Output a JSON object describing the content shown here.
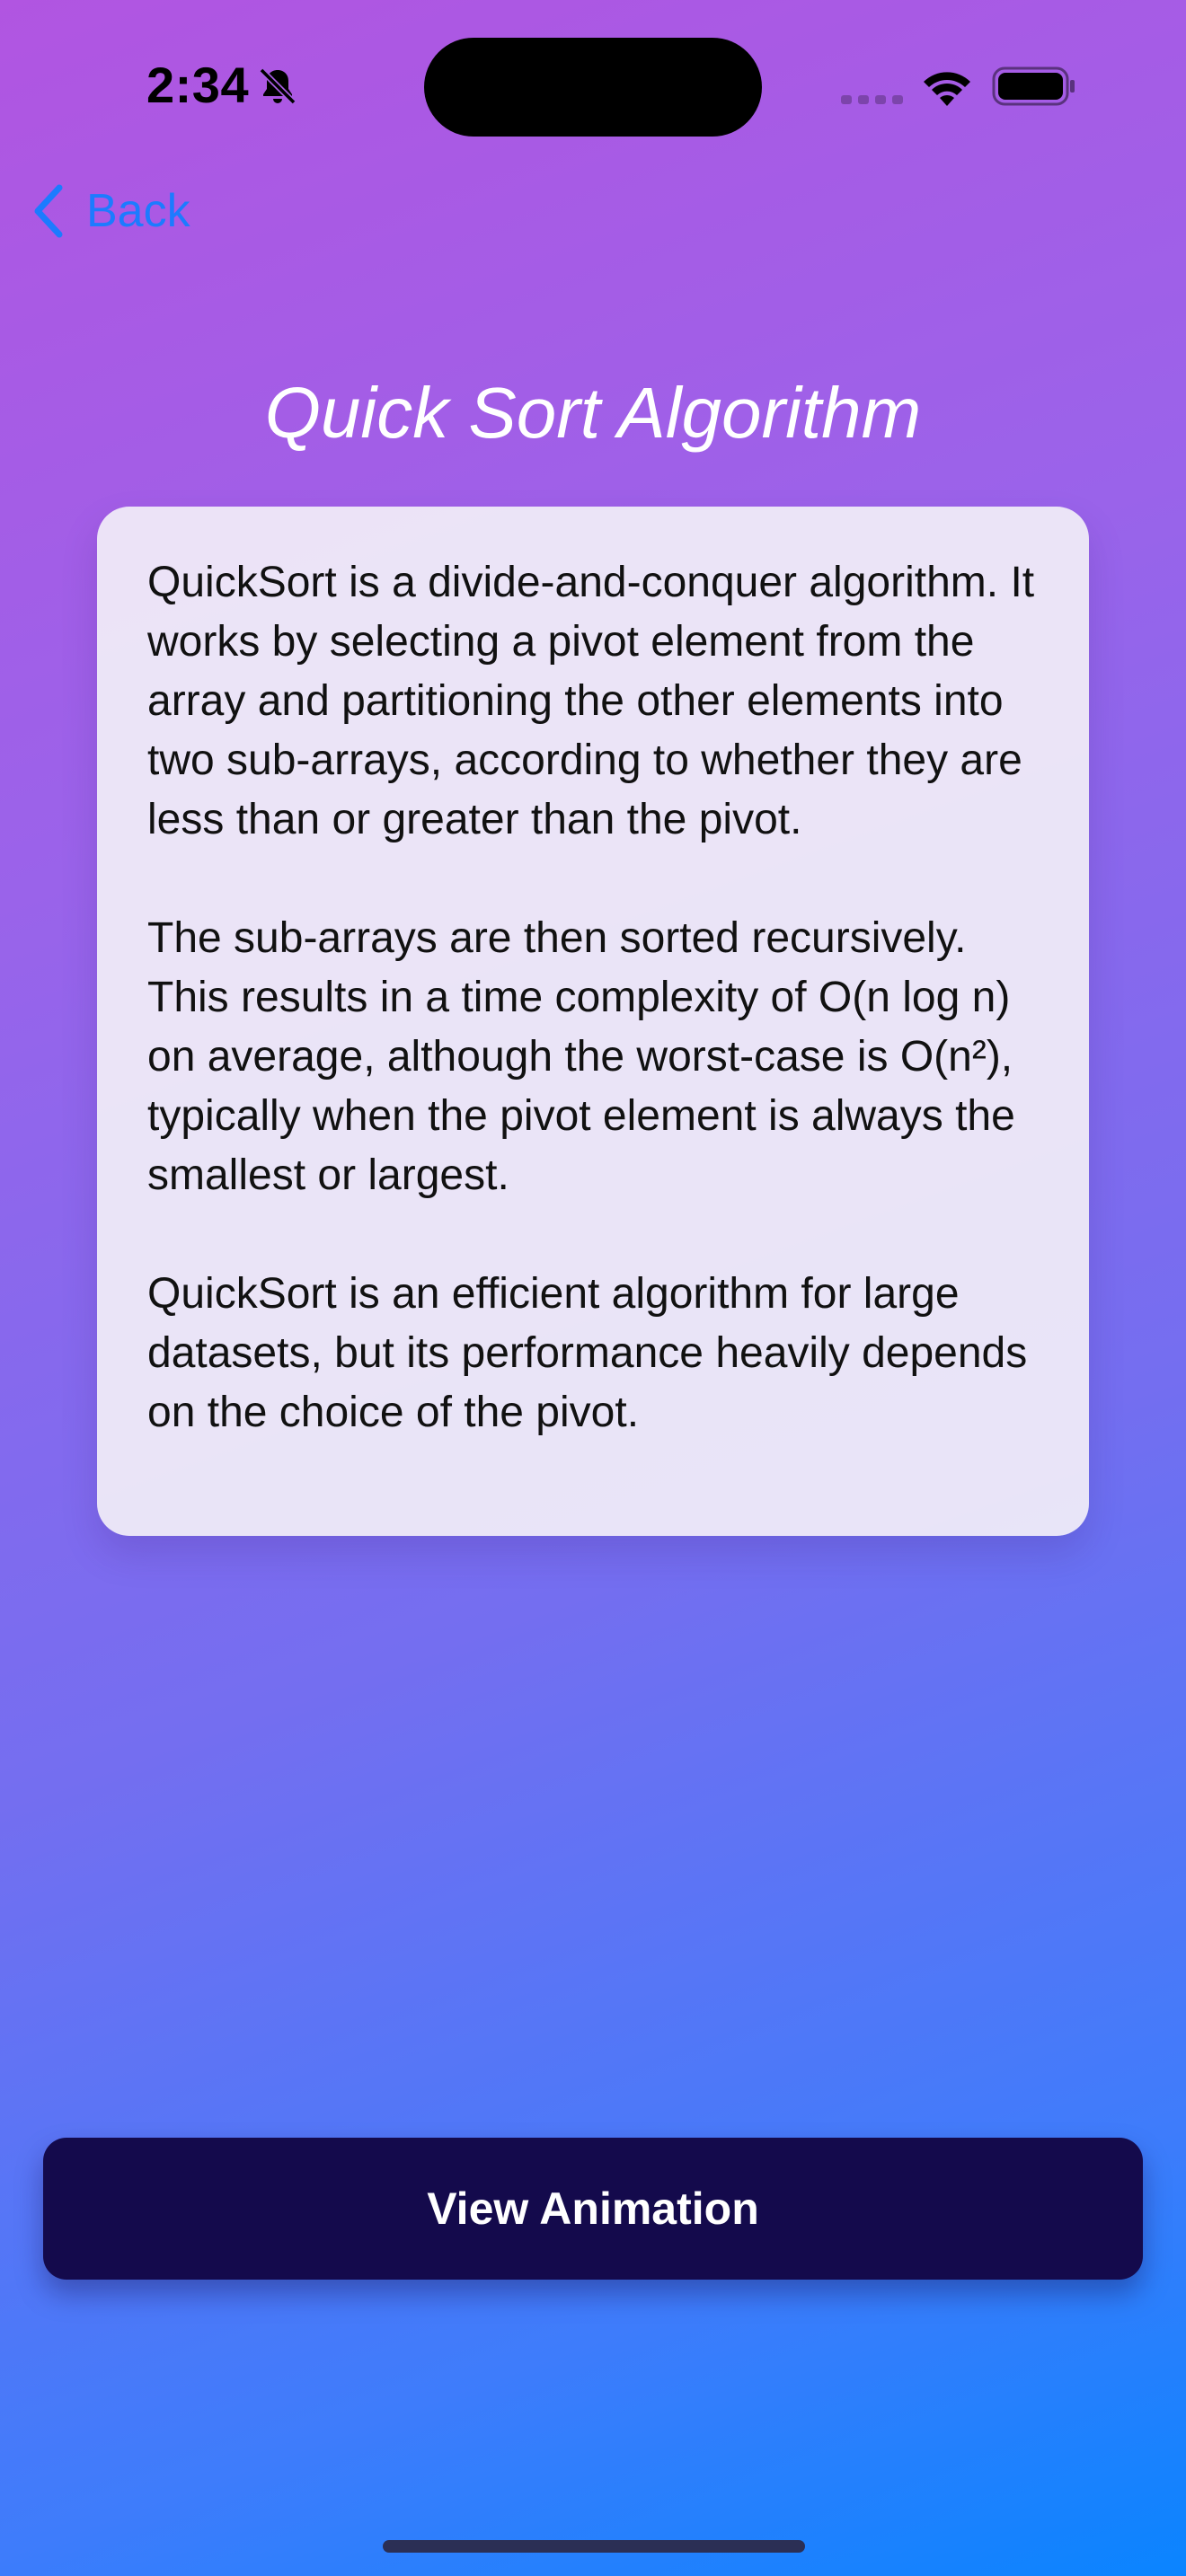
{
  "status_bar": {
    "time": "2:34",
    "icons": {
      "silent": "bell-slash-icon",
      "signal": "cellular-signal-icon",
      "wifi": "wifi-icon",
      "battery": "battery-icon"
    }
  },
  "nav": {
    "back_label": "Back",
    "back_icon": "chevron-left-icon",
    "accent_color": "#1c7bff"
  },
  "page": {
    "title": "Quick Sort Algorithm"
  },
  "description": {
    "paragraphs": [
      "QuickSort is a divide-and-conquer algorithm. It works by selecting a pivot element from the array and partitioning the other elements into two sub-arrays, according to whether they are less than or greater than the pivot.",
      "The sub-arrays are then sorted recursively. This results in a time complexity of O(n log n) on average, although the worst-case is O(n²), typically when the pivot element is always the smallest or largest.",
      "QuickSort is an efficient algorithm for large datasets, but its performance heavily depends on the choice of the pivot."
    ]
  },
  "actions": {
    "view_animation_label": "View Animation",
    "button_color": "#140a4c"
  },
  "colors": {
    "gradient_start": "#b155e1",
    "gradient_end": "#0a84ff",
    "card_background": "#f0ecf8"
  }
}
